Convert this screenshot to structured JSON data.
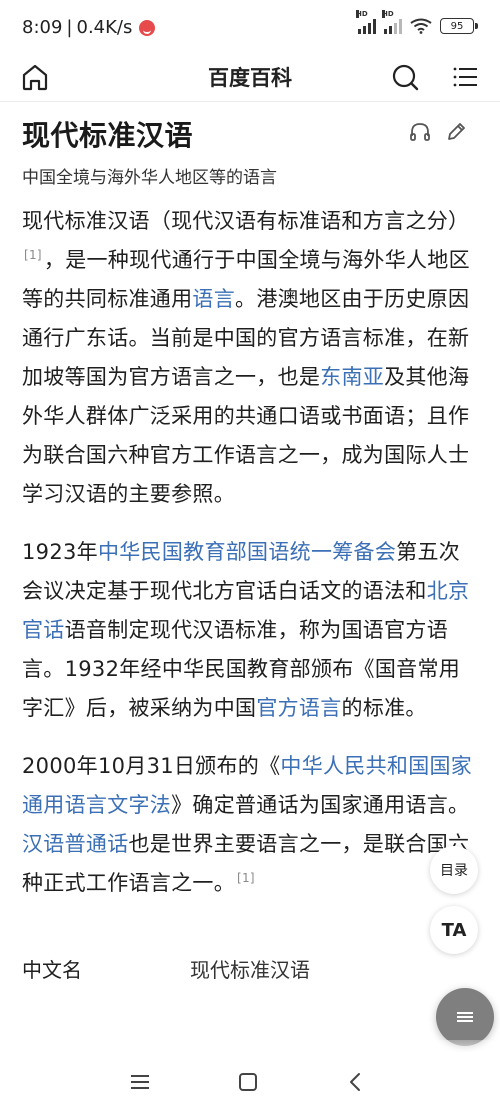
{
  "status": {
    "time": "8:09",
    "network_speed": "0.4K/s",
    "signal_1_label": "HD",
    "signal_2_label": "HD",
    "battery": "95"
  },
  "appbar": {
    "title": "百度百科",
    "icons": [
      "home-icon",
      "search-icon",
      "menu-icon"
    ]
  },
  "article": {
    "title": "现代标准汉语",
    "subtitle": "中国全境与海外华人地区等的语言",
    "p1": {
      "t1": "现代标准汉语（现代汉语有标准语和方言之分）",
      "ref1": "[1]",
      "t2": "，是一种现代通行于中国全境与海外华人地区等的共同标准通用",
      "link1": "语言",
      "t3": "。港澳地区由于历史原因通行广东话。当前是中国的官方语言标准，在新加坡等国为官方语言之一，也是",
      "link2": "东南亚",
      "t4": "及其他海外华人群体广泛采用的共通口语或书面语；且作为联合国六种官方工作语言之一，成为国际人士学习汉语的主要参照。"
    },
    "p2": {
      "t1": "1923年",
      "link1": "中华民国教育部国语统一筹备会",
      "t2": "第五次会议决定基于现代北方官话白话文的语法和",
      "link2": "北京官话",
      "t3": "语音制定现代汉语标准，称为国语官方语言。1932年经中华民国教育部颁布《国音常用字汇》后，被采纳为中国",
      "link3": "官方语言",
      "t4": "的标准。"
    },
    "p3": {
      "t1": "2000年10月31日颁布的《",
      "link1": "中华人民共和国国家通用语言文字法",
      "t2": "》确定普通话为国家通用语言。",
      "link2": "汉语普通话",
      "t3": "也是世界主要语言之一，是联合国六种正式工作语言之一。",
      "ref1": "[1]"
    },
    "infobox": {
      "label": "中文名",
      "value": "现代标准汉语"
    }
  },
  "floating": {
    "toc_label": "目录",
    "ta_label": "TA"
  },
  "colors": {
    "link": "#3b6fb6",
    "text": "#1f1f1f",
    "fab_more": "#7f7f7f"
  }
}
